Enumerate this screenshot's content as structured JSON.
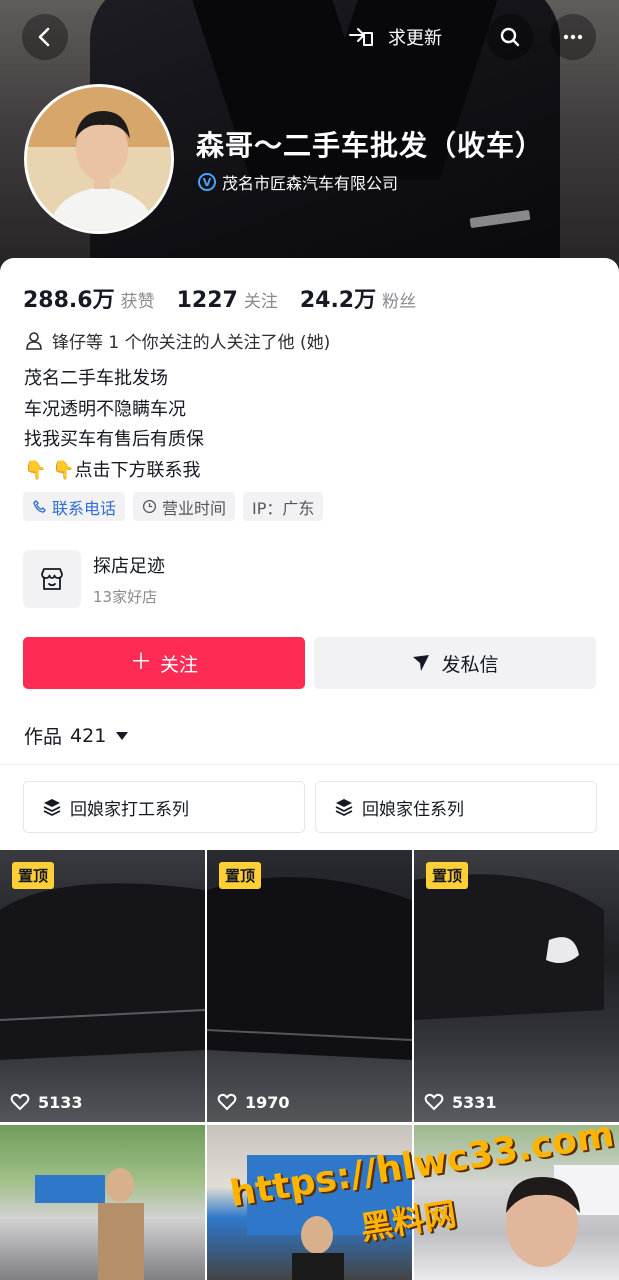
{
  "header": {
    "update_label": "求更新",
    "nickname": "森哥～二手车批发（收车）",
    "company": "茂名市匠森汽车有限公司"
  },
  "stats": [
    {
      "value": "288.6万",
      "label": "获赞"
    },
    {
      "value": "1227",
      "label": "关注"
    },
    {
      "value": "24.2万",
      "label": "粉丝"
    }
  ],
  "follower_text": "锋仔等 1 个你关注的人关注了他 (她)",
  "bio": [
    "茂名二手车批发场",
    "车况透明不隐瞒车况",
    "找我买车有售后有质保",
    "👇 👇点击下方联系我"
  ],
  "tags": {
    "phone": "联系电话",
    "hours": "营业时间",
    "ip": "IP：广东"
  },
  "visit": {
    "title": "探店足迹",
    "count": "13家好店"
  },
  "buttons": {
    "follow": "关注",
    "message": "发私信"
  },
  "works": {
    "label": "作品",
    "count": "421"
  },
  "collections": [
    "回娘家打工系列",
    "回娘家住系列"
  ],
  "videos": [
    {
      "pinned": "置顶",
      "likes": "5133"
    },
    {
      "pinned": "置顶",
      "likes": "1970"
    },
    {
      "pinned": "置顶",
      "likes": "5331"
    }
  ],
  "watermark": {
    "line1": "https://hlwc33.com",
    "line2": "黑料网"
  },
  "colors": {
    "accent": "#fe2c55",
    "pin": "#ffd036",
    "watermark": "#ffb400"
  }
}
